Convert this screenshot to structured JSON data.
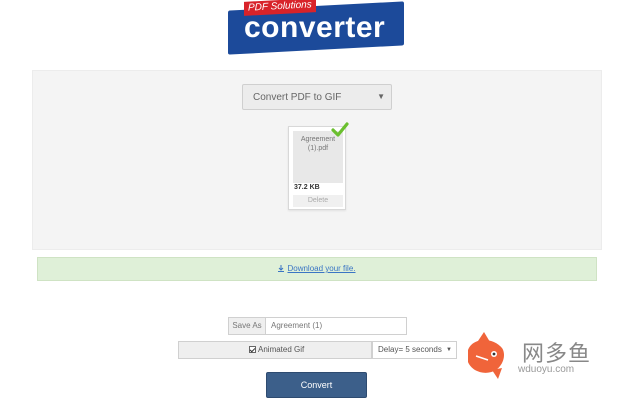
{
  "logo": {
    "tag": "PDF Solutions",
    "wordmark": "converter"
  },
  "converter": {
    "format_select": "Convert PDF to GIF",
    "file": {
      "name": "Agreement (1).pdf",
      "size": "37.2 KB",
      "delete_label": "Delete",
      "status": "uploaded"
    }
  },
  "download": {
    "link_text": "Download your file."
  },
  "options": {
    "save_as_label": "Save As",
    "save_as_value": "Agreement (1)",
    "animated_label": "Animated Gif",
    "animated_checked": true,
    "delay_value": "Delay= 5 seconds"
  },
  "actions": {
    "convert_label": "Convert"
  },
  "watermark": {
    "chinese": "网多鱼",
    "url": "wduoyu.com"
  },
  "colors": {
    "logo_blue": "#1c4a9a",
    "logo_red": "#d8232a",
    "success_bg": "#dff0d8",
    "button_blue": "#3c5f8a",
    "check_green": "#6abf2e"
  }
}
